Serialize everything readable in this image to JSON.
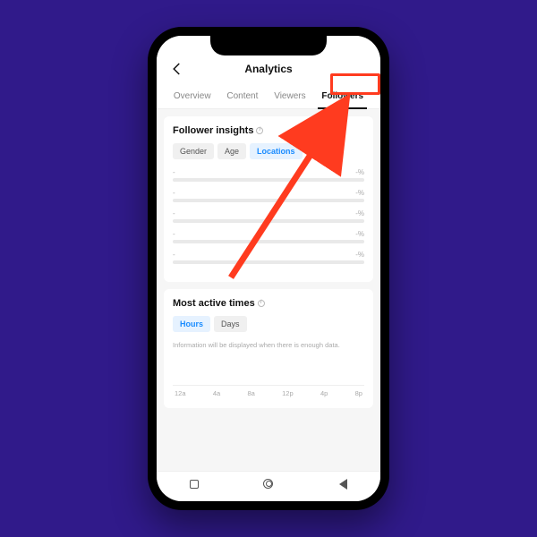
{
  "header": {
    "title": "Analytics",
    "tabs": [
      "Overview",
      "Content",
      "Viewers",
      "Followers"
    ],
    "active_tab_index": 3
  },
  "insights": {
    "title": "Follower insights",
    "segments": [
      "Gender",
      "Age",
      "Locations"
    ],
    "active_segment_index": 2,
    "rows": [
      {
        "label": "-",
        "value": "-%"
      },
      {
        "label": "-",
        "value": "-%"
      },
      {
        "label": "-",
        "value": "-%"
      },
      {
        "label": "-",
        "value": "-%"
      },
      {
        "label": "-",
        "value": "-%"
      }
    ]
  },
  "active_times": {
    "title": "Most active times",
    "segments": [
      "Hours",
      "Days"
    ],
    "active_segment_index": 0,
    "message": "Information will be displayed when there is enough data.",
    "x_ticks": [
      "12a",
      "4a",
      "8a",
      "12p",
      "4p",
      "8p"
    ]
  },
  "annotation": {
    "highlight_target": "tab-followers",
    "arrow_color": "#ff3b1f"
  },
  "chart_data": [
    {
      "type": "bar",
      "title": "Follower insights — Locations",
      "categories": [
        "-",
        "-",
        "-",
        "-",
        "-"
      ],
      "values": [
        null,
        null,
        null,
        null,
        null
      ],
      "ylabel": "%",
      "note": "empty state"
    },
    {
      "type": "bar",
      "title": "Most active times — Hours",
      "categories": [
        "12a",
        "4a",
        "8a",
        "12p",
        "4p",
        "8p"
      ],
      "values": [
        null,
        null,
        null,
        null,
        null,
        null
      ],
      "note": "Information will be displayed when there is enough data."
    }
  ]
}
